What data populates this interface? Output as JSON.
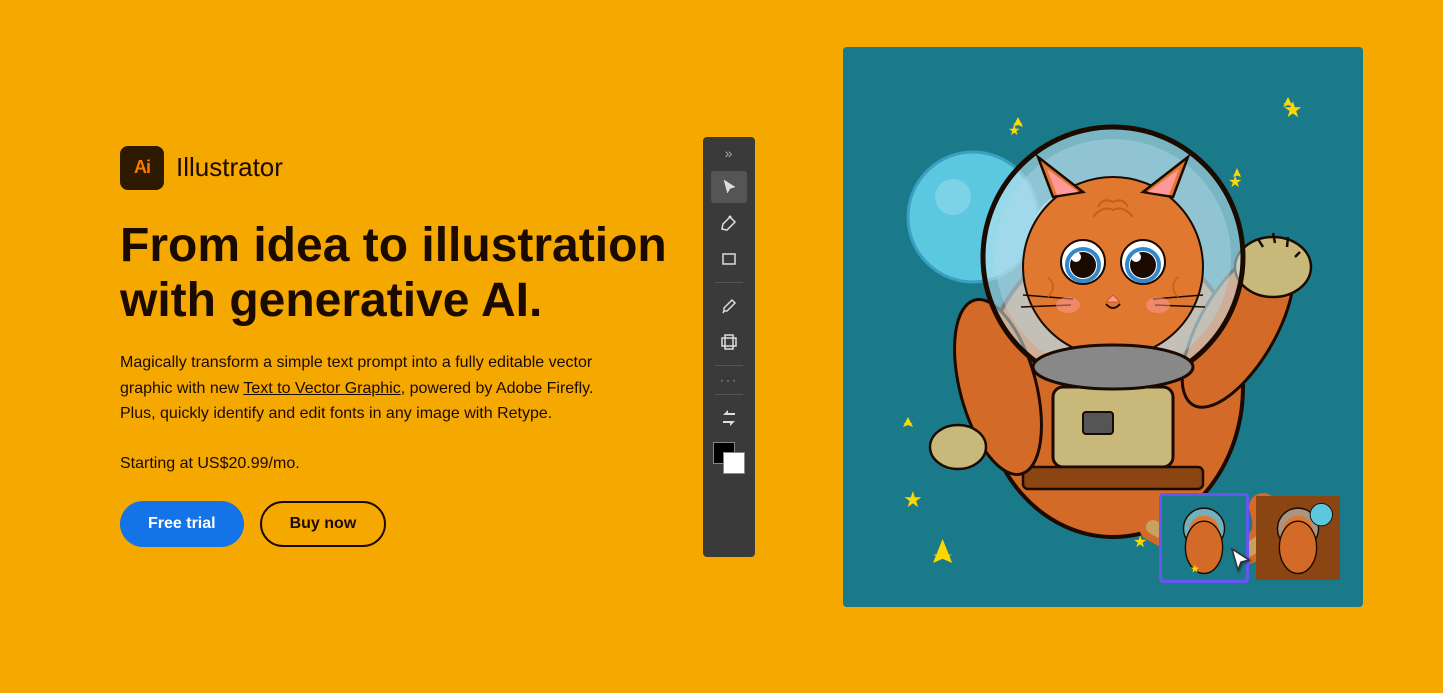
{
  "brand": {
    "logo_text": "Ai",
    "name": "Illustrator"
  },
  "hero": {
    "headline_line1": "From idea to illustration",
    "headline_line2": "with generative AI.",
    "description_before_link": "Magically transform a simple text prompt into a fully editable vector graphic with new ",
    "link_text": "Text to Vector Graphic",
    "description_after_link": ", powered by Adobe Firefly. Plus, quickly identify and edit fonts in any image with Retype.",
    "pricing": "Starting at US$20.99/mo."
  },
  "cta": {
    "free_trial_label": "Free trial",
    "buy_now_label": "Buy now"
  },
  "toolbar": {
    "grip_label": "»",
    "dots_label": "···",
    "tools": [
      {
        "name": "select",
        "icon": "▶"
      },
      {
        "name": "pen",
        "icon": "✒"
      },
      {
        "name": "rectangle",
        "icon": "▭"
      },
      {
        "name": "eyedropper",
        "icon": "⌇"
      },
      {
        "name": "shape",
        "icon": "▬"
      }
    ]
  },
  "thumbnails": [
    {
      "id": 1,
      "label": "thumbnail-1",
      "selected": true
    },
    {
      "id": 2,
      "label": "thumbnail-2",
      "selected": false
    }
  ],
  "colors": {
    "background": "#F5A800",
    "illustration_bg": "#1A7A8A",
    "toolbar_bg": "#3A3A3A",
    "cta_primary": "#1473E6",
    "thumbnail_selected_border": "#6655EE",
    "thumbnail2_bg": "#8B4513"
  }
}
